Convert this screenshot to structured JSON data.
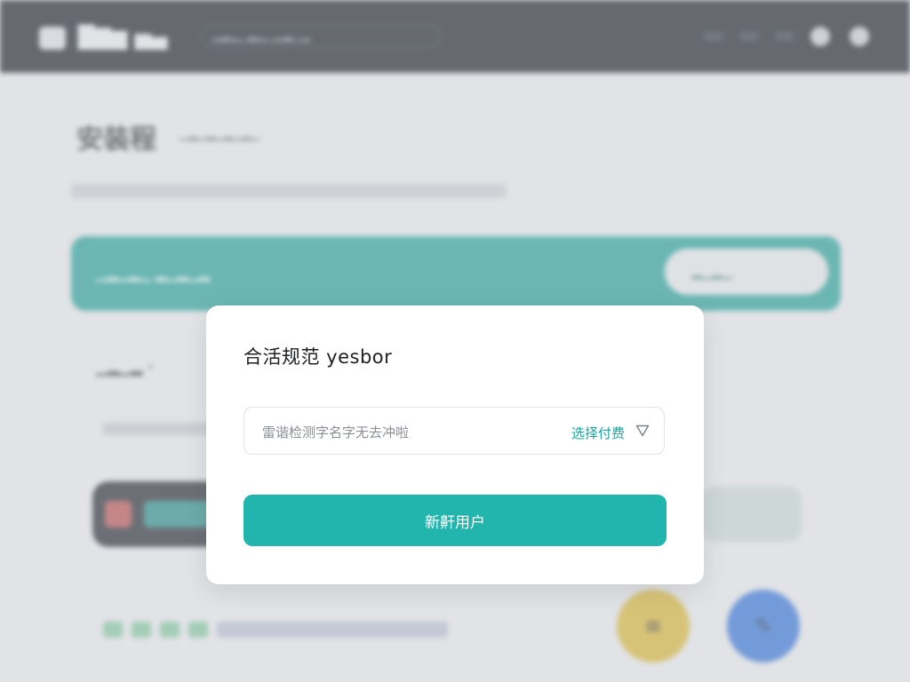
{
  "background": {
    "app_name": "█▇▆ ▅▄",
    "search_placeholder": "▂▃▂▁▃▂▁▂▃▁▂",
    "page_title": "安装程",
    "page_subtitle": "▁▂▁▂▁▂▁▂▁",
    "banner_text": "▁▂▁▂▁ ▂▁▂▁▂",
    "banner_button": "▂▁▂▁",
    "section_label": "▁▂▁▂ ·",
    "circle_yellow_icon": "menu-icon",
    "circle_blue_icon": "edit-icon"
  },
  "modal": {
    "title": "合活规范 yesbor",
    "select": {
      "placeholder": "雷谐检测字名字无去冲啦",
      "value": "选择付费"
    },
    "primary_button": "新鼾用户"
  },
  "colors": {
    "accent": "#22b5ae",
    "accent_text": "#1aa6a0",
    "topbar": "#151b22",
    "banner": "#1e9e95",
    "circle_yellow": "#d8b42e",
    "circle_blue": "#2e6fd6"
  }
}
